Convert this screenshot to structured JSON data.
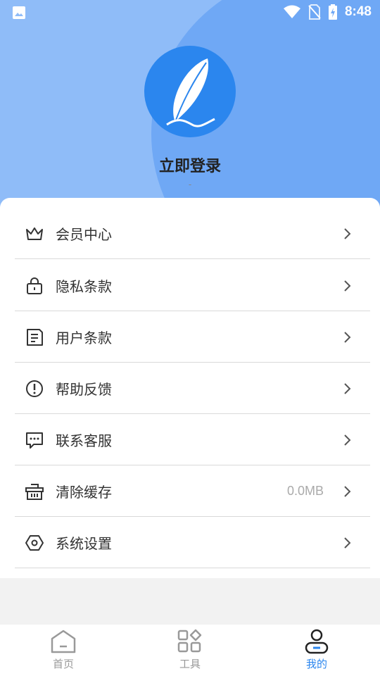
{
  "status_bar": {
    "time": "8:48"
  },
  "profile": {
    "login_text": "立即登录",
    "subtitle": "-"
  },
  "menu": [
    {
      "label": "会员中心",
      "icon": "crown-icon"
    },
    {
      "label": "隐私条款",
      "icon": "lock-icon"
    },
    {
      "label": "用户条款",
      "icon": "document-icon"
    },
    {
      "label": "帮助反馈",
      "icon": "exclamation-circle-icon"
    },
    {
      "label": "联系客服",
      "icon": "chat-bubble-icon"
    },
    {
      "label": "清除缓存",
      "icon": "basket-icon",
      "value": "0.0MB"
    },
    {
      "label": "系统设置",
      "icon": "hexagon-settings-icon"
    }
  ],
  "tabs": [
    {
      "label": "首页",
      "icon": "home-icon"
    },
    {
      "label": "工具",
      "icon": "tools-grid-icon"
    },
    {
      "label": "我的",
      "icon": "user-icon",
      "active": true
    }
  ],
  "colors": {
    "accent": "#2b86ee",
    "header_bg": "#8fbcf8",
    "header_circle": "#6fa8f5"
  }
}
